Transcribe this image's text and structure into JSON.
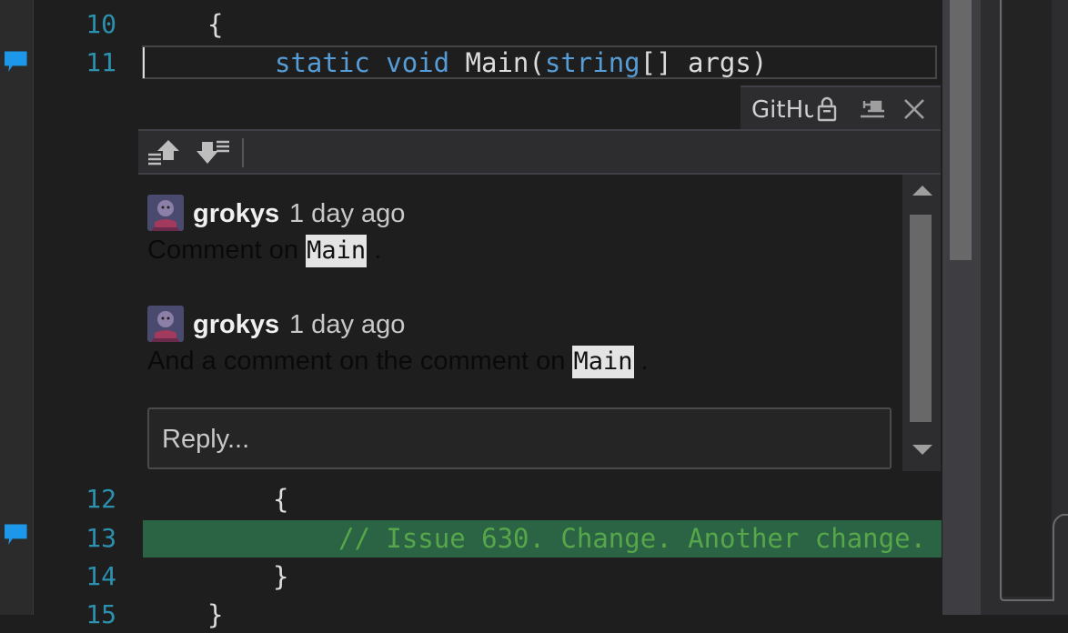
{
  "editor": {
    "lines": [
      {
        "number": "10",
        "text": "{"
      },
      {
        "number": "11",
        "kw1": "static",
        "kw2": "void",
        "name": "Main(",
        "type": "string",
        "rest": "[] args)"
      },
      {
        "number": "12",
        "text": "{"
      },
      {
        "number": "13",
        "text": "// Issue 630. Change. Another change."
      },
      {
        "number": "14",
        "text": "}"
      },
      {
        "number": "15",
        "text": "}"
      }
    ]
  },
  "peek": {
    "tab_title": "GitHub",
    "icons": {
      "lock": "lock-icon",
      "pin": "pin-icon",
      "close": "close-icon",
      "prev": "previous-comment-icon",
      "next": "next-comment-icon"
    },
    "comments": [
      {
        "author": "grokys",
        "time": "1 day ago",
        "text_before": "Comment on ",
        "code": "Main",
        "text_after": "."
      },
      {
        "author": "grokys",
        "time": "1 day ago",
        "text_before": "And a comment on the comment on ",
        "code": "Main",
        "text_after": "."
      }
    ],
    "reply_placeholder": "Reply..."
  },
  "colors": {
    "keyword": "#569cd6",
    "line_number": "#2b91af",
    "comment": "#57a64a",
    "added_line": "#2a6444",
    "comment_glyph": "#1c97ea"
  }
}
